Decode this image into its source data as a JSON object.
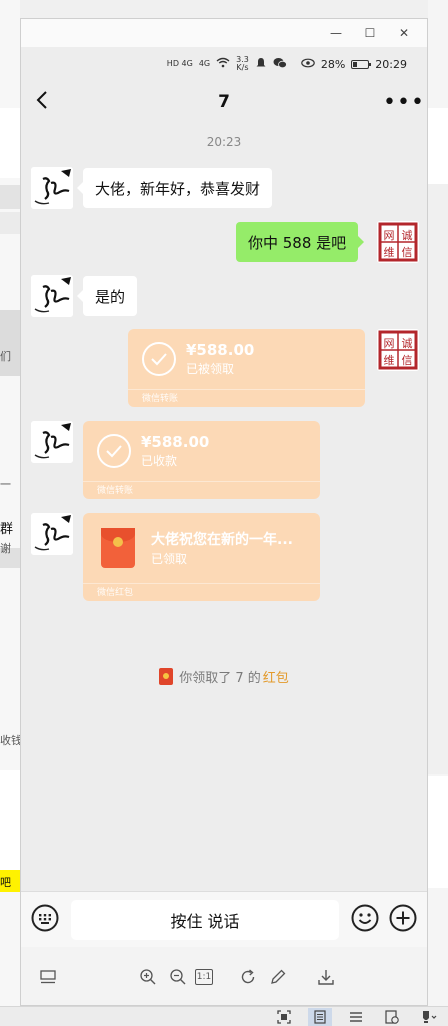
{
  "window": {
    "controls": [
      "—",
      "☐",
      "✕"
    ]
  },
  "status_bar": {
    "signal_a": "HD 4G",
    "signal_b": "4G",
    "speed": "3.3\nK/s",
    "battery": "28%",
    "time": "20:29"
  },
  "nav": {
    "back_icon": "chevron-left-icon",
    "title": "7",
    "more_label": "•••"
  },
  "chat": {
    "timestamp": "20:23",
    "messages": [
      {
        "side": "left",
        "type": "text",
        "text": "大佬，新年好，恭喜发财"
      },
      {
        "side": "right",
        "type": "text",
        "text": "你中 588 是吧"
      },
      {
        "side": "left",
        "type": "text",
        "text": "是的"
      },
      {
        "side": "right",
        "type": "transfer",
        "amount": "¥588.00",
        "status": "已被领取",
        "footer": "微信转账"
      },
      {
        "side": "left",
        "type": "transfer",
        "amount": "¥588.00",
        "status": "已收款",
        "footer": "微信转账"
      },
      {
        "side": "left",
        "type": "red_packet",
        "title": "大佬祝您在新的一年...",
        "status": "已领取",
        "footer": "微信红包"
      }
    ],
    "system_note": {
      "prefix": "你领取了 7 的",
      "highlight": "红包"
    },
    "avatar_right_text": [
      "网",
      "诚",
      "维",
      "信"
    ]
  },
  "input_bar": {
    "voice_label": "按住 说话",
    "keyboard_icon": "keyboard-icon",
    "emoji_icon": "emoji-icon",
    "plus_icon": "plus-icon"
  },
  "toolbar": {
    "actual_size_label": "1:1"
  },
  "colors": {
    "window_bg": "#ededed",
    "bubble_out": "#95ec69",
    "transfer_card": "#fcd9b6",
    "highlight": "#e39a2b"
  },
  "background_fragments": {
    "left_1": "们",
    "left_2": "一",
    "left_3": "群",
    "left_4": "谢",
    "left_5": "收钱",
    "left_6": "吧",
    "right_strip": ""
  }
}
